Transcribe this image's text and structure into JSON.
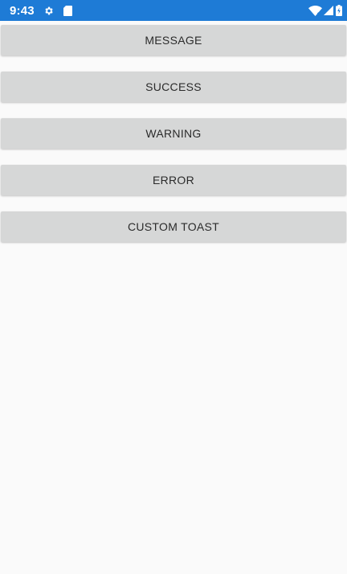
{
  "status_bar": {
    "time": "9:43",
    "icons": [
      "gear-icon",
      "sd-card-icon",
      "wifi-icon",
      "signal-icon",
      "battery-icon"
    ],
    "background_color": "#1e7bd6"
  },
  "buttons": [
    {
      "label": "MESSAGE"
    },
    {
      "label": "SUCCESS"
    },
    {
      "label": "WARNING"
    },
    {
      "label": "ERROR"
    },
    {
      "label": "CUSTOM TOAST"
    }
  ],
  "colors": {
    "page_background": "#fafafa",
    "button_background": "#d6d7d7",
    "button_text": "#2b2b2b"
  }
}
